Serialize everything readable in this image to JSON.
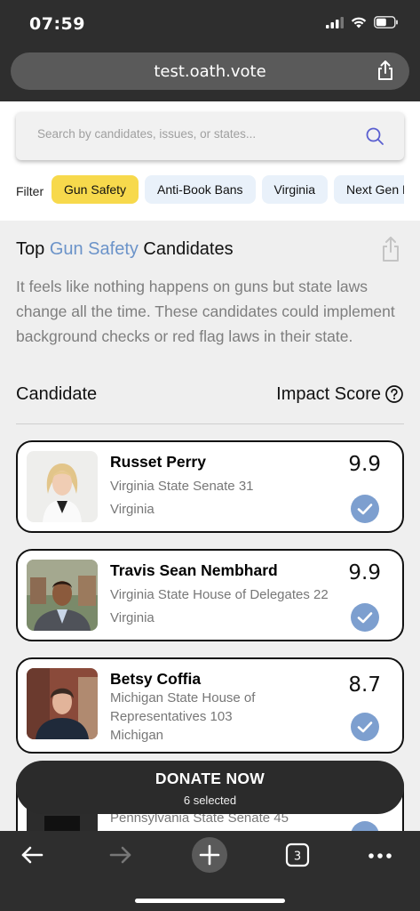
{
  "status": {
    "time": "07:59"
  },
  "browser": {
    "url": "test.oath.vote",
    "tabs_count": "3"
  },
  "search": {
    "placeholder": "Search by candidates, issues, or states..."
  },
  "filter": {
    "label": "Filter",
    "chips": [
      {
        "label": "Gun Safety",
        "active": true
      },
      {
        "label": "Anti-Book Bans",
        "active": false
      },
      {
        "label": "Virginia",
        "active": false
      },
      {
        "label": "Next Gen L",
        "active": false
      }
    ]
  },
  "section": {
    "title_prefix": "Top ",
    "title_issue": "Gun Safety",
    "title_suffix": " Candidates",
    "description": "It feels like nothing happens on guns but state laws change all the time. These candidates could implement background checks or red flag laws in their state.",
    "col_candidate": "Candidate",
    "col_impact": "Impact Score"
  },
  "candidates": [
    {
      "name": "Russet Perry",
      "office": "Virginia State Senate 31",
      "state": "Virginia",
      "score": "9.9",
      "selected": true
    },
    {
      "name": "Travis Sean Nembhard",
      "office": "Virginia State House of Delegates 22",
      "state": "Virginia",
      "score": "9.9",
      "selected": true
    },
    {
      "name": "Betsy Coffia",
      "office": "Michigan State House of Representatives 103",
      "state": "Michigan",
      "score": "8.7",
      "selected": true
    },
    {
      "name": "",
      "office": "Pennsylvania State Senate 45",
      "state": "",
      "score": "",
      "selected": true
    }
  ],
  "donate": {
    "label": "DONATE NOW",
    "sub": "6 selected"
  },
  "colors": {
    "accent": "#6b93c9",
    "chip_active": "#f7d94c",
    "chip": "#e9f1fa",
    "check": "#7d9fcf"
  }
}
